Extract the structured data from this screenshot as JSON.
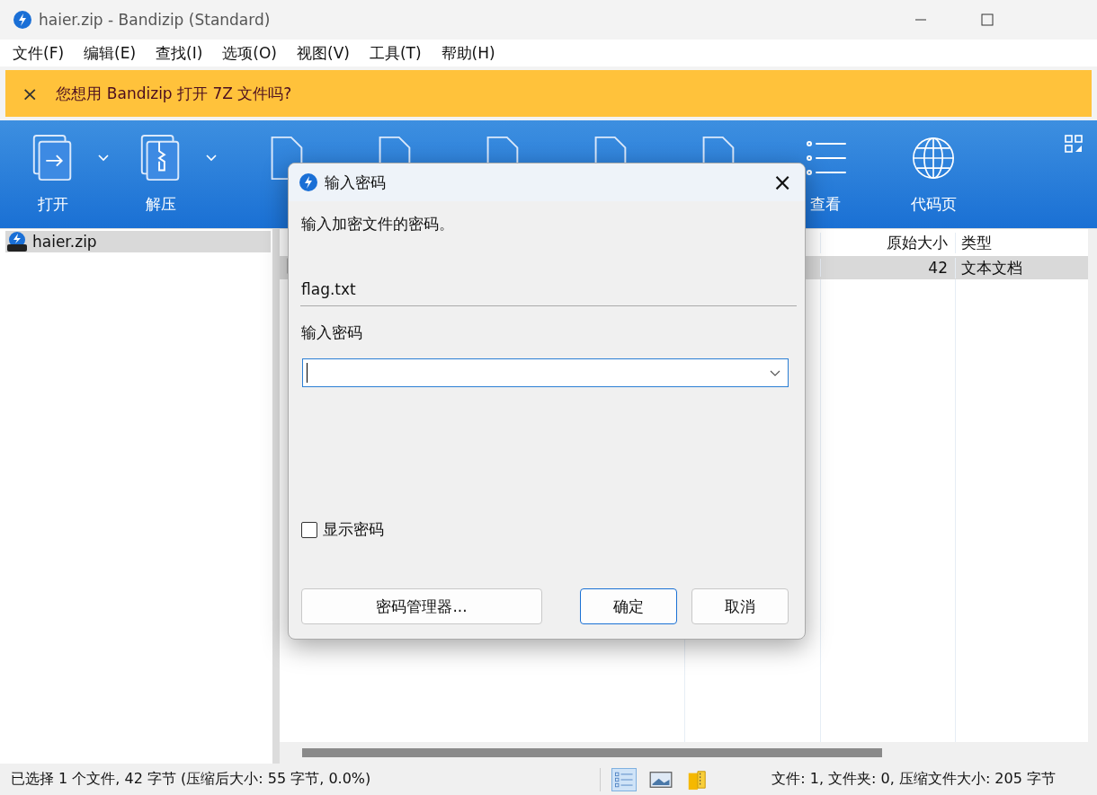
{
  "window": {
    "title": "haier.zip - Bandizip (Standard)"
  },
  "menu": [
    "文件(F)",
    "编辑(E)",
    "查找(I)",
    "选项(O)",
    "视图(V)",
    "工具(T)",
    "帮助(H)"
  ],
  "banner": {
    "close": "×",
    "text": "您想用 Bandizip 打开 7Z 文件吗?"
  },
  "toolbar": [
    {
      "kind": "open",
      "label": "打开",
      "dropdown": true
    },
    {
      "kind": "extract",
      "label": "解压",
      "dropdown": true
    },
    {
      "kind": "document"
    },
    {
      "kind": "document"
    },
    {
      "kind": "document"
    },
    {
      "kind": "document"
    },
    {
      "kind": "document"
    },
    {
      "kind": "list",
      "label": "查看"
    },
    {
      "kind": "globe",
      "label": "代码页"
    }
  ],
  "tree": [
    {
      "label": "haier.zip",
      "selected": true
    }
  ],
  "table": {
    "columns": [
      "原始大小",
      "类型"
    ],
    "rows": [
      {
        "size": "42",
        "type": "文本文档",
        "selected": true
      }
    ]
  },
  "status_bar": {
    "left": "已选择 1 个文件, 42 字节 (压缩后大小: 55 字节, 0.0%)",
    "right": "文件: 1, 文件夹: 0, 压缩文件大小: 205 字节"
  },
  "dialog": {
    "title": "输入密码",
    "close": "×",
    "description": "输入加密文件的密码。",
    "file": "flag.txt",
    "field_label": "输入密码",
    "show_password": {
      "label": "显示密码",
      "checked": false
    },
    "buttons": [
      {
        "label": "密码管理器...",
        "kind": "wide",
        "default": false
      },
      {
        "label": "确定",
        "kind": "normal",
        "default": true
      },
      {
        "label": "取消",
        "kind": "normal",
        "default": false
      }
    ]
  }
}
